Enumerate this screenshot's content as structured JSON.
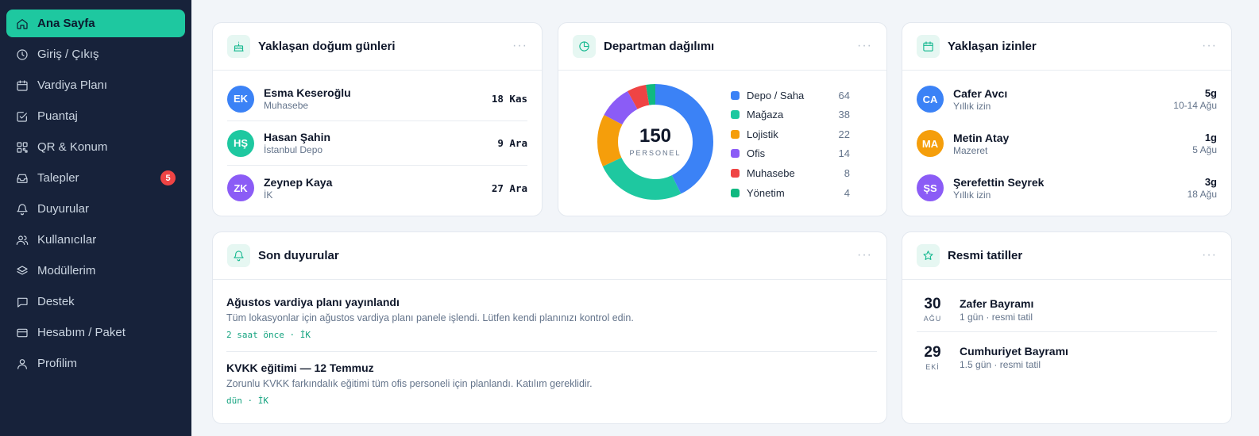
{
  "sidebar": {
    "items": [
      {
        "label": "Ana Sayfa",
        "icon": "home-icon",
        "active": true
      },
      {
        "label": "Giriş / Çıkış",
        "icon": "clock-icon"
      },
      {
        "label": "Vardiya Planı",
        "icon": "calendar-icon"
      },
      {
        "label": "Puantaj",
        "icon": "checklist-icon"
      },
      {
        "label": "QR & Konum",
        "icon": "qr-icon"
      },
      {
        "label": "Talepler",
        "icon": "inbox-icon",
        "badge": "5"
      },
      {
        "label": "Duyurular",
        "icon": "bell-icon"
      },
      {
        "label": "Kullanıcılar",
        "icon": "users-icon"
      },
      {
        "label": "Modüllerim",
        "icon": "layers-icon"
      },
      {
        "label": "Destek",
        "icon": "chat-icon"
      },
      {
        "label": "Hesabım / Paket",
        "icon": "credit-card-icon"
      },
      {
        "label": "Profilim",
        "icon": "user-icon"
      }
    ]
  },
  "birthdays": {
    "title": "Yaklaşan doğum günleri",
    "more": "···",
    "rows": [
      {
        "initials": "EK",
        "name": "Esma Keseroğlu",
        "dept": "Muhasebe",
        "date": "18 Kas",
        "color": "#3b82f6"
      },
      {
        "initials": "HŞ",
        "name": "Hasan Şahin",
        "dept": "İstanbul Depo",
        "date": "9 Ara",
        "color": "#1ec8a0"
      },
      {
        "initials": "ZK",
        "name": "Zeynep Kaya",
        "dept": "İK",
        "date": "27 Ara",
        "color": "#8b5cf6"
      }
    ]
  },
  "departments": {
    "title": "Departman dağılımı",
    "more": "···",
    "total": "150",
    "total_label": "PERSONEL",
    "items": [
      {
        "name": "Depo / Saha",
        "value": 64,
        "color": "#3b82f6"
      },
      {
        "name": "Mağaza",
        "value": 38,
        "color": "#1ec8a0"
      },
      {
        "name": "Lojistik",
        "value": 22,
        "color": "#f59e0b"
      },
      {
        "name": "Ofis",
        "value": 14,
        "color": "#8b5cf6"
      },
      {
        "name": "Muhasebe",
        "value": 8,
        "color": "#ef4444"
      },
      {
        "name": "Yönetim",
        "value": 4,
        "color": "#10b981"
      }
    ]
  },
  "leaves": {
    "title": "Yaklaşan izinler",
    "more": "···",
    "rows": [
      {
        "initials": "CA",
        "name": "Cafer Avcı",
        "type": "Yıllık izin",
        "days": "5g",
        "range": "10-14 Ağu",
        "color": "#3b82f6"
      },
      {
        "initials": "MA",
        "name": "Metin Atay",
        "type": "Mazeret",
        "days": "1g",
        "range": "5 Ağu",
        "color": "#f59e0b"
      },
      {
        "initials": "ŞS",
        "name": "Şerefettin Seyrek",
        "type": "Yıllık izin",
        "days": "3g",
        "range": "18 Ağu",
        "color": "#8b5cf6"
      }
    ]
  },
  "announcements": {
    "title": "Son duyurular",
    "more": "···",
    "items": [
      {
        "title": "Ağustos vardiya planı yayınlandı",
        "desc": "Tüm lokasyonlar için ağustos vardiya planı panele işlendi. Lütfen kendi planınızı kontrol edin.",
        "meta": "2 saat önce · İK"
      },
      {
        "title": "KVKK eğitimi — 12 Temmuz",
        "desc": "Zorunlu KVKK farkındalık eğitimi tüm ofis personeli için planlandı. Katılım gereklidir.",
        "meta": "dün · İK"
      }
    ]
  },
  "holidays": {
    "title": "Resmi tatiller",
    "more": "···",
    "items": [
      {
        "day": "30",
        "month": "AĞU",
        "name": "Zafer Bayramı",
        "sub": "1 gün · resmi tatil"
      },
      {
        "day": "29",
        "month": "EKİ",
        "name": "Cumhuriyet Bayramı",
        "sub": "1.5 gün · resmi tatil"
      }
    ]
  }
}
